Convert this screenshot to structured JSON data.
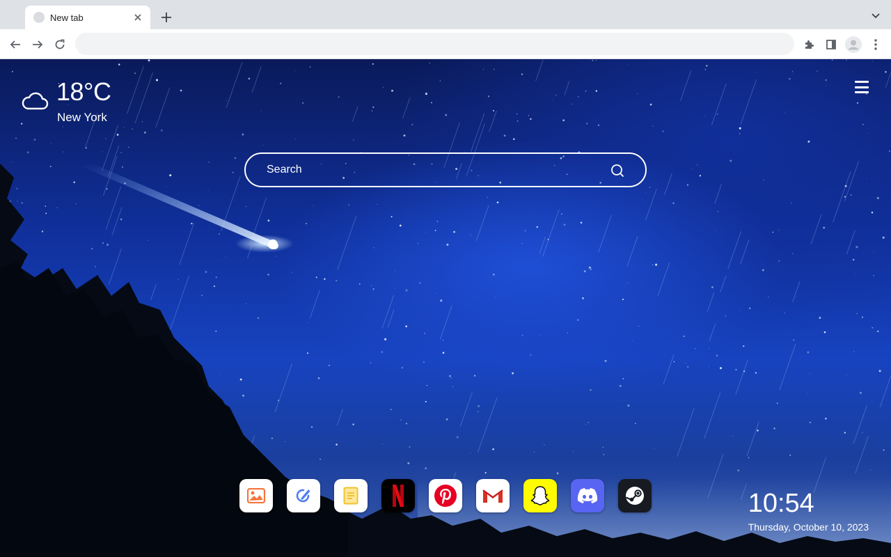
{
  "browser": {
    "tab": {
      "title": "New tab"
    },
    "omnibox": {
      "value": "",
      "placeholder": ""
    },
    "icons": [
      "back-icon",
      "forward-icon",
      "reload-icon",
      "extensions-icon",
      "side-panel-icon",
      "profile-icon",
      "kebab-menu-icon",
      "close-icon",
      "plus-icon",
      "chevron-down-icon"
    ]
  },
  "weather": {
    "temperature": "18°C",
    "city": "New York",
    "icon": "cloud-icon"
  },
  "search": {
    "placeholder": "Search"
  },
  "dock": {
    "apps": [
      {
        "name": "photos",
        "icon": "image-icon",
        "bg": "#ffffff",
        "accent": "#f5743b"
      },
      {
        "name": "edit",
        "icon": "pen-icon",
        "bg": "#ffffff",
        "accent": "#4f7df3"
      },
      {
        "name": "notes",
        "icon": "note-icon",
        "bg": "#ffffff",
        "accent": "#f2c230"
      },
      {
        "name": "netflix",
        "icon": "netflix-icon",
        "bg": "#000000",
        "accent": "#e50914"
      },
      {
        "name": "pinterest",
        "icon": "pinterest-icon",
        "bg": "#ffffff",
        "accent": "#e60023"
      },
      {
        "name": "gmail",
        "icon": "gmail-icon",
        "bg": "#ffffff",
        "accent": "#d93025"
      },
      {
        "name": "snapchat",
        "icon": "snapchat-icon",
        "bg": "#fffc00",
        "accent": "#ffffff"
      },
      {
        "name": "discord",
        "icon": "discord-icon",
        "bg": "#5865f2",
        "accent": "#ffffff"
      },
      {
        "name": "steam",
        "icon": "steam-icon",
        "bg": "#171a21",
        "accent": "#ffffff"
      }
    ]
  },
  "clock": {
    "time": "10:54",
    "date": "Thursday, October 10, 2023"
  }
}
